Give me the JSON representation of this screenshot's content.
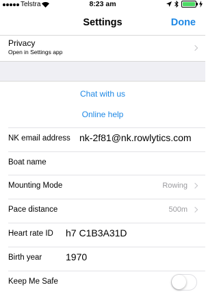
{
  "status_bar": {
    "carrier": "Telstra",
    "time": "8:23 am",
    "icons": [
      "signal-icon",
      "wifi-icon",
      "location-icon",
      "bluetooth-icon",
      "battery-icon",
      "charging-icon"
    ]
  },
  "nav": {
    "title": "Settings",
    "done_label": "Done"
  },
  "privacy": {
    "title": "Privacy",
    "subtitle": "Open in Settings app"
  },
  "links": {
    "chat": "Chat with us",
    "help": "Online help"
  },
  "rows": {
    "email": {
      "label": "NK email address",
      "value": "nk-2f81@nk.rowlytics.com"
    },
    "boat": {
      "label": "Boat name",
      "value": ""
    },
    "mounting": {
      "label": "Mounting Mode",
      "value": "Rowing"
    },
    "pace": {
      "label": "Pace distance",
      "value": "500m"
    },
    "heart": {
      "label": "Heart rate ID",
      "value": "h7 C1B3A31D"
    },
    "birth": {
      "label": "Birth year",
      "value": "1970"
    },
    "safe": {
      "label": "Keep Me Safe",
      "toggle_on": false
    }
  },
  "colors": {
    "accent": "#1e88e5",
    "battery": "#4cd964",
    "grouped_bg": "#efeff4"
  }
}
